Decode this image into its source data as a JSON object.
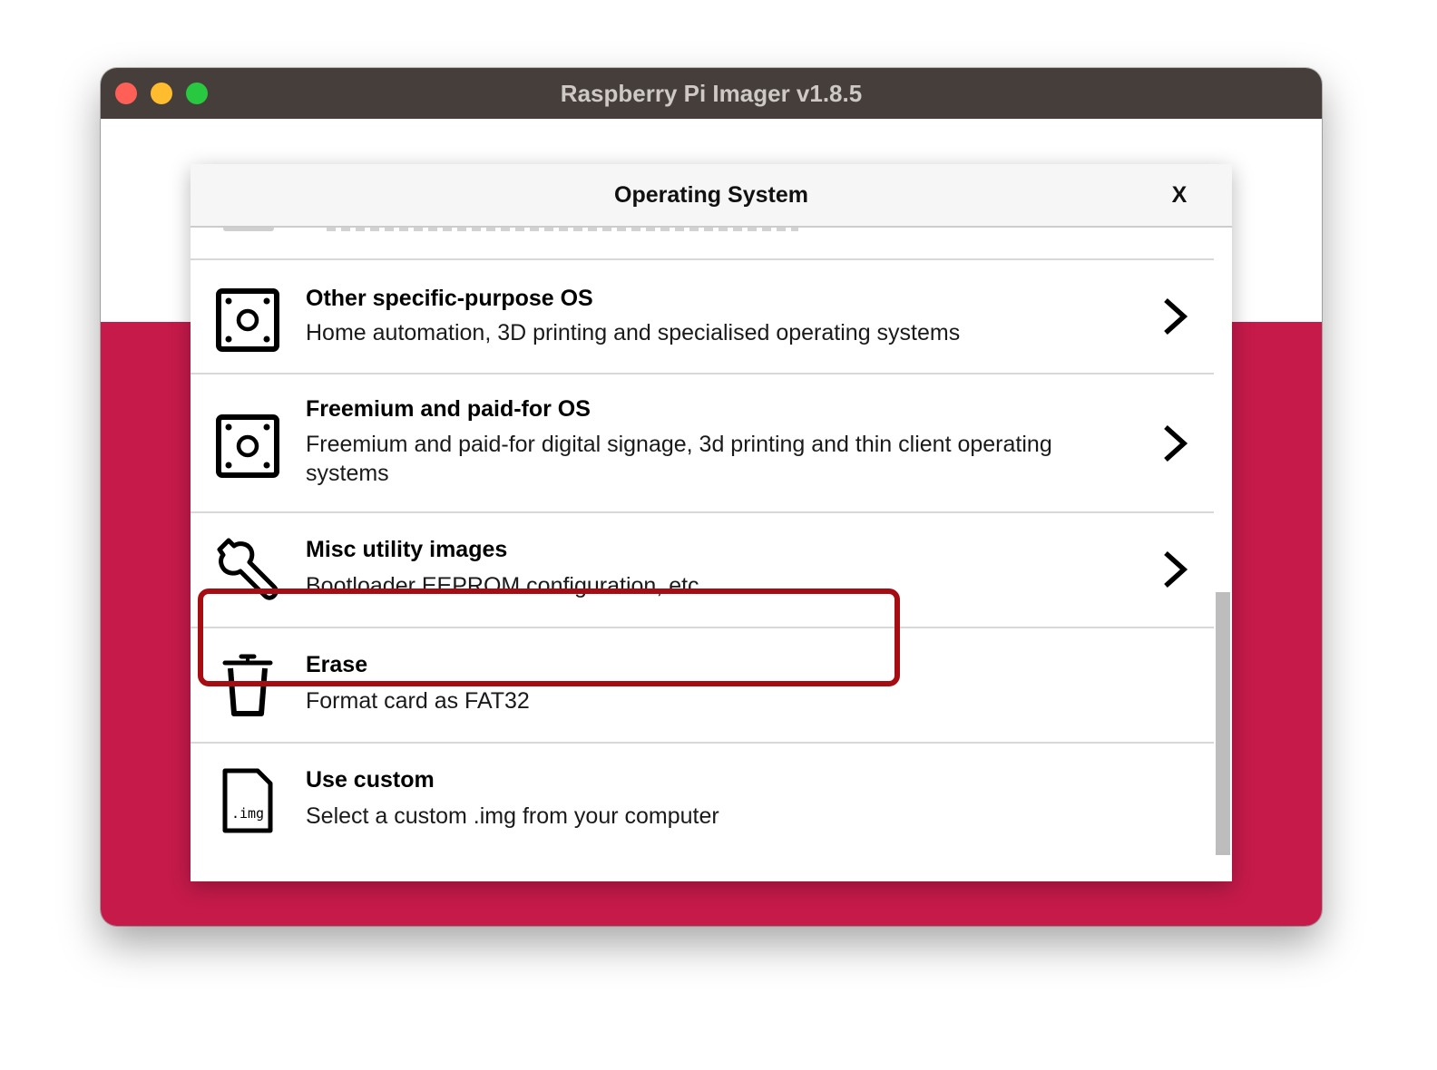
{
  "window": {
    "title": "Raspberry Pi Imager v1.8.5"
  },
  "dialog": {
    "title": "Operating System",
    "close_label": "X"
  },
  "items": [
    {
      "title": "Other specific-purpose OS",
      "description": "Home automation, 3D printing and specialised operating systems",
      "icon": "os-board-icon",
      "has_submenu": true
    },
    {
      "title": "Freemium and paid-for OS",
      "description": "Freemium and paid-for digital signage, 3d printing and thin client operating systems",
      "icon": "os-board-icon",
      "has_submenu": true
    },
    {
      "title": "Misc utility images",
      "description": "Bootloader EEPROM configuration, etc.",
      "icon": "wrench-icon",
      "has_submenu": true,
      "highlighted": true
    },
    {
      "title": "Erase",
      "description": "Format card as FAT32",
      "icon": "trash-icon",
      "has_submenu": false
    },
    {
      "title": "Use custom",
      "description": "Select a custom .img from your computer",
      "icon": "img-file-icon",
      "icon_text": ".img",
      "has_submenu": false
    }
  ],
  "colors": {
    "titlebar": "#453e3a",
    "brand_raspberry": "#c51a4a",
    "highlight_border": "#a50d12"
  }
}
